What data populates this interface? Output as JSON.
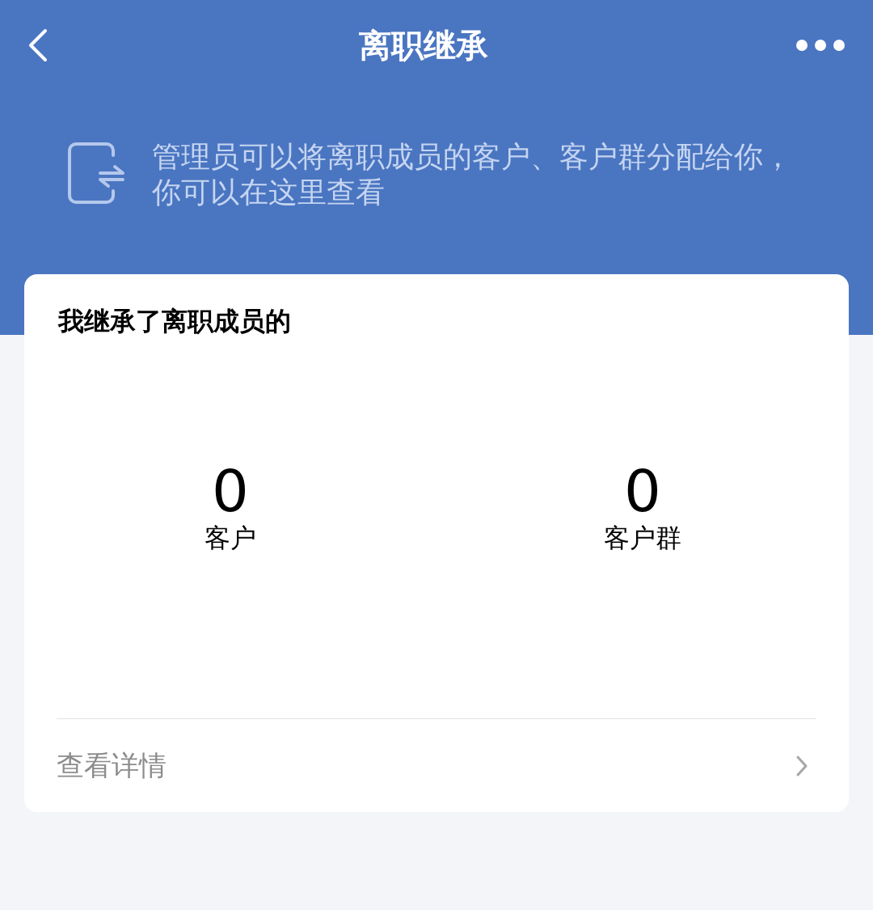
{
  "header": {
    "title": "离职继承"
  },
  "notice": {
    "text": "管理员可以将离职成员的客户、客户群分配给你，你可以在这里查看"
  },
  "card": {
    "title": "我继承了离职成员的",
    "stats": [
      {
        "value": "0",
        "label": "客户"
      },
      {
        "value": "0",
        "label": "客户群"
      }
    ],
    "link": "查看详情"
  }
}
